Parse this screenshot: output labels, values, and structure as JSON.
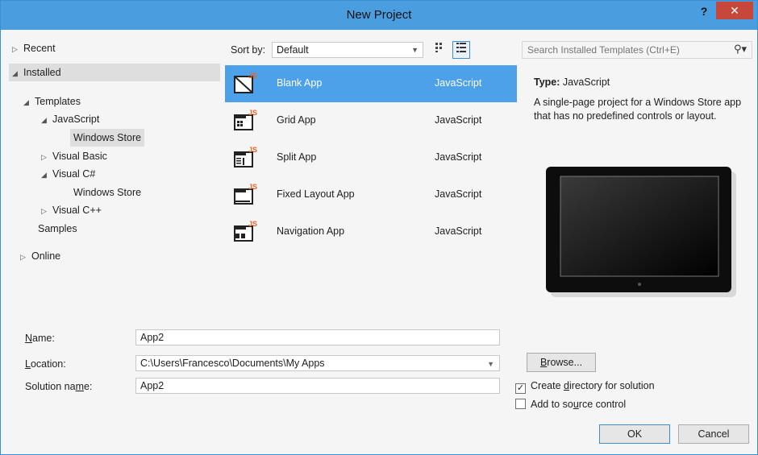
{
  "window": {
    "title": "New Project",
    "help": "?",
    "close": "✕"
  },
  "tree": {
    "recent": "Recent",
    "installed": "Installed",
    "templates": "Templates",
    "javascript": "JavaScript",
    "js_windows_store": "Windows Store",
    "visual_basic": "Visual Basic",
    "visual_csharp": "Visual C#",
    "cs_windows_store": "Windows Store",
    "visual_cpp": "Visual C++",
    "samples": "Samples",
    "online": "Online"
  },
  "sort": {
    "label": "Sort by:",
    "value": "Default"
  },
  "templates": [
    {
      "name": "Blank App",
      "lang": "JavaScript",
      "badge": "JS",
      "selected": true
    },
    {
      "name": "Grid App",
      "lang": "JavaScript",
      "badge": "JS",
      "selected": false
    },
    {
      "name": "Split App",
      "lang": "JavaScript",
      "badge": "JS",
      "selected": false
    },
    {
      "name": "Fixed Layout App",
      "lang": "JavaScript",
      "badge": "JS",
      "selected": false
    },
    {
      "name": "Navigation App",
      "lang": "JavaScript",
      "badge": "JS",
      "selected": false
    }
  ],
  "search": {
    "placeholder": "Search Installed Templates (Ctrl+E)"
  },
  "details": {
    "type_label": "Type:",
    "type_value": "JavaScript",
    "description": "A single-page project for a Windows Store app that has no predefined controls or layout."
  },
  "form": {
    "name_label_pre": "",
    "name_label_u": "N",
    "name_label_post": "ame:",
    "name_value": "App2",
    "location_label_pre": "",
    "location_label_u": "L",
    "location_label_post": "ocation:",
    "location_value": "C:\\Users\\Francesco\\Documents\\My Apps",
    "solution_label_pre": "Solution na",
    "solution_label_u": "m",
    "solution_label_post": "e:",
    "solution_value": "App2",
    "browse_label_pre": "",
    "browse_label_u": "B",
    "browse_label_post": "rowse...",
    "create_dir_pre": "Create ",
    "create_dir_u": "d",
    "create_dir_post": "irectory for solution",
    "create_dir_checked": true,
    "source_ctrl_pre": "Add to so",
    "source_ctrl_u": "u",
    "source_ctrl_post": "rce control",
    "source_ctrl_checked": false,
    "ok_label": "OK",
    "cancel_label": "Cancel"
  },
  "colors": {
    "titlebar": "#4a9ee0",
    "selection": "#4ca1e8",
    "close": "#c7483a",
    "js_badge": "#e8642a"
  }
}
